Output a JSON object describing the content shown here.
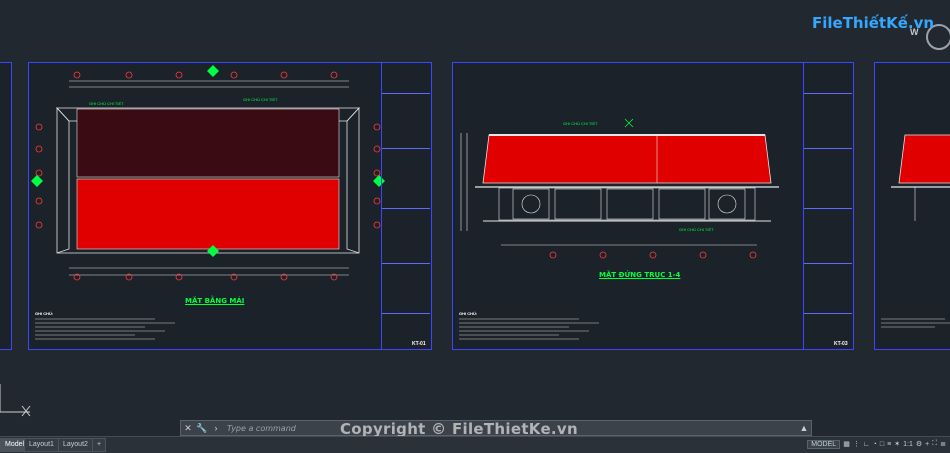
{
  "logo": {
    "text": "FileThiếtKế.vn",
    "badge": "W"
  },
  "drawing": {
    "sheet1": {
      "title": "MẶT BẰNG MÁI",
      "sheet_id": "KT-01"
    },
    "sheet2": {
      "title": "MẶT ĐỨNG TRỤC 1-4",
      "sheet_id": "KT-03"
    },
    "notes_heading": "GHI CHÚ:"
  },
  "command": {
    "placeholder": "Type a command"
  },
  "tabs": [
    {
      "label": "Model"
    },
    {
      "label": "Layout1"
    },
    {
      "label": "Layout2"
    }
  ],
  "status": {
    "model": "MODEL",
    "scale": "1:1"
  },
  "copyright": "Copyright © FileThietKe.vn",
  "colors": {
    "background": "#212830",
    "frame": "#3a46ff",
    "roof": "#e00000",
    "green": "#00ff40"
  }
}
